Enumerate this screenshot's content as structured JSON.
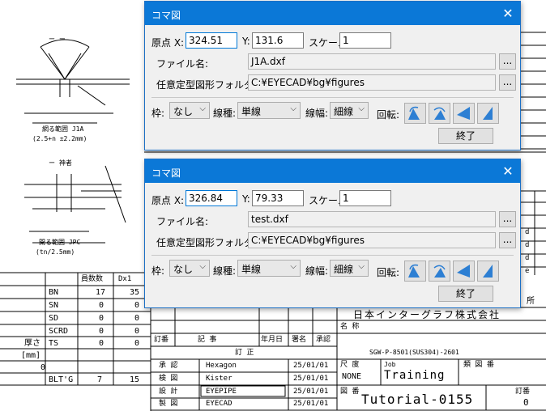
{
  "cad_text": {
    "section1": "ー ー",
    "section2": "ー 神者",
    "note1": "(2.5+n ±2.2mm)",
    "note2": "(tn/2.5mm)",
    "caption1": "網る範囲 J1A",
    "caption2": "開る範囲 JPC",
    "parts_header": [
      "員数数",
      "Dx1"
    ],
    "parts_rows": [
      {
        "name": "BN",
        "v1": "17",
        "v2": "35"
      },
      {
        "name": "SN",
        "v1": "0",
        "v2": "0"
      },
      {
        "name": "SD",
        "v1": "0",
        "v2": "0"
      },
      {
        "name": "SCRD",
        "v1": "0",
        "v2": "0"
      },
      {
        "name": "TS",
        "v1": "0",
        "v2": "0"
      },
      {
        "name": "",
        "v1": "",
        "v2": ""
      },
      {
        "name": "",
        "v1": "",
        "v2": ""
      },
      {
        "name": "BLT'G",
        "v1": "7",
        "v2": "15"
      }
    ],
    "left_labels": [
      "厚さ",
      "[mm]",
      "0"
    ],
    "rev_header": [
      "訂番",
      "記 事",
      "年月日",
      "署名",
      "承認"
    ],
    "rev_title": "訂 正",
    "sign_rows": [
      {
        "role": "承 認",
        "name": "Hexagon",
        "date": "25/01/01"
      },
      {
        "role": "検 図",
        "name": "Kister",
        "date": "25/01/01"
      },
      {
        "role": "設 計",
        "name": "EYEPIPE",
        "date": "25/01/01"
      },
      {
        "role": "製 図",
        "name": "EYECAD",
        "date": "25/01/01"
      }
    ],
    "company": "日本インターグラフ株式会社",
    "place": "所",
    "name_label": "名 称",
    "drawing_code": "SGW-P-8501(SUS304)-2601",
    "scale_label": "尺 度",
    "scale_value": "NONE",
    "job_label": "Job",
    "job_value": "Training",
    "dwg_label": "図 番",
    "dwg_value": "Tutorial-0155",
    "rev_label": "訂番",
    "rev_value": "0",
    "sim_label": "類 図 番",
    "right_col": [
      "d",
      "d",
      "d",
      "e"
    ]
  },
  "dialog1": {
    "title": "コマ図",
    "x_label": "原点 X:",
    "x_value": "324.51",
    "y_label": "Y:",
    "y_value": "131.6",
    "scale_label": "スケール:",
    "scale_value": "1",
    "file_label": "ファイル名:",
    "file_value": "J1A.dxf",
    "folder_label": "任意定型図形フォルダ:",
    "folder_value": "C:¥EYECAD¥bg¥figures",
    "browse_label": "...",
    "frame_label": "枠:",
    "frame_value": "なし",
    "ltype_label": "線種:",
    "ltype_value": "単線",
    "lwidth_label": "線幅:",
    "lwidth_value": "細線",
    "rotate_label": "回転:",
    "end_label": "終了"
  },
  "dialog2": {
    "title": "コマ図",
    "x_label": "原点 X:",
    "x_value": "326.84",
    "y_label": "Y:",
    "y_value": "79.33",
    "scale_label": "スケール:",
    "scale_value": "1",
    "file_label": "ファイル名:",
    "file_value": "test.dxf",
    "folder_label": "任意定型図形フォルダ:",
    "folder_value": "C:¥EYECAD¥bg¥figures",
    "browse_label": "...",
    "frame_label": "枠:",
    "frame_value": "なし",
    "ltype_label": "線種:",
    "ltype_value": "単線",
    "lwidth_label": "線幅:",
    "lwidth_value": "細線",
    "rotate_label": "回転:",
    "end_label": "終了"
  },
  "colors": {
    "titlebar": "#0b78d7",
    "dialog_bg": "#f0f0f0",
    "focus": "#0078d7"
  }
}
